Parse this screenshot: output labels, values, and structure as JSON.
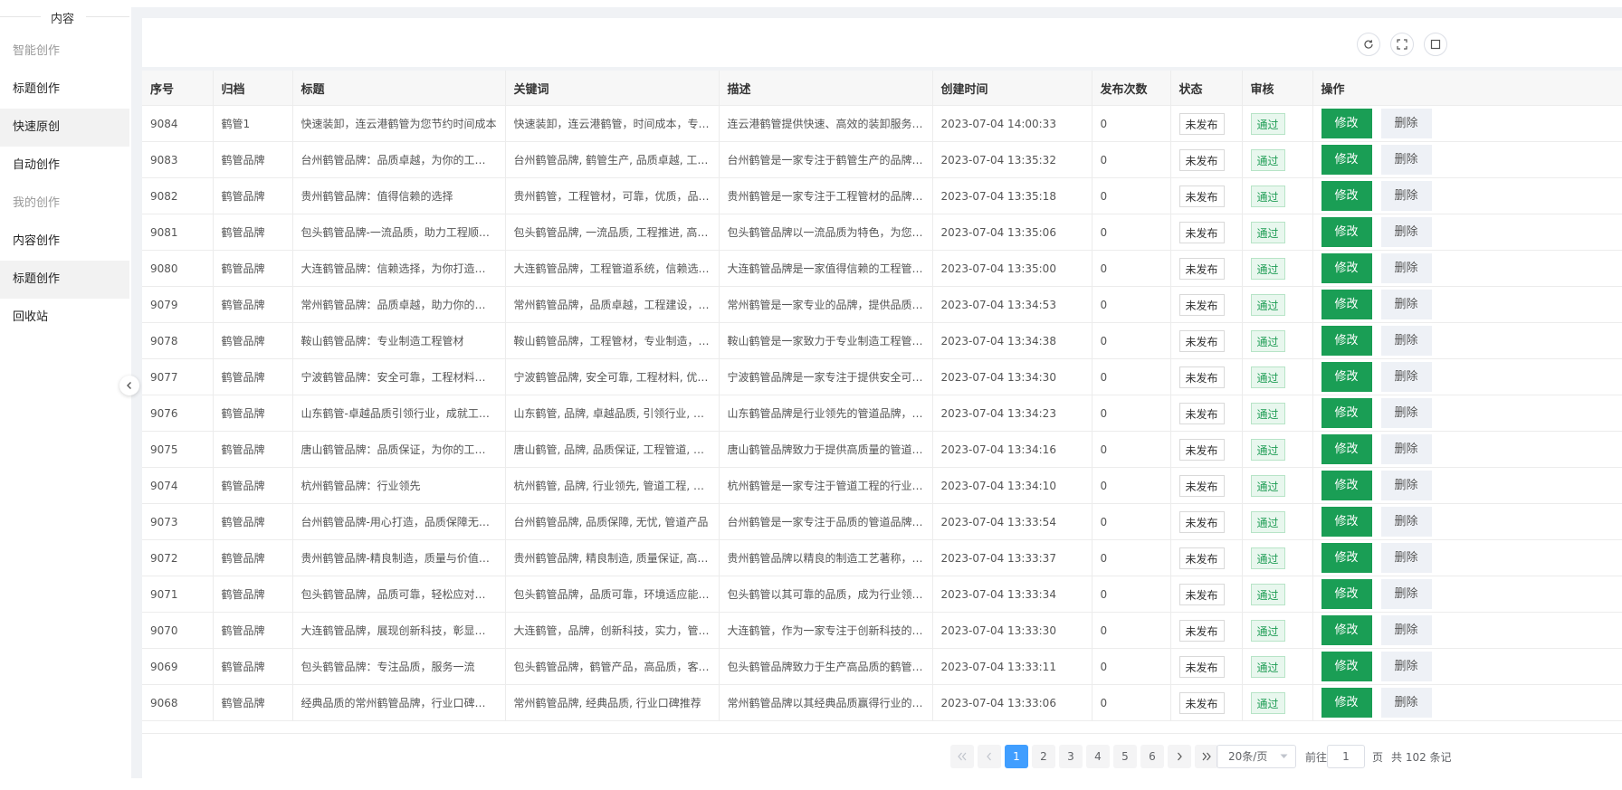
{
  "sidebar": {
    "header": "内容",
    "items": [
      {
        "label": "智能创作",
        "group": true
      },
      {
        "label": "标题创作"
      },
      {
        "label": "快速原创",
        "active": true
      },
      {
        "label": "自动创作"
      },
      {
        "label": "我的创作",
        "group": true
      },
      {
        "label": "内容创作"
      },
      {
        "label": "标题创作",
        "active": true
      },
      {
        "label": "回收站"
      }
    ]
  },
  "table": {
    "columns": [
      "序号",
      "归档",
      "标题",
      "关键词",
      "描述",
      "创建时间",
      "发布次数",
      "状态",
      "审核",
      "操作"
    ],
    "edit_label": "修改",
    "delete_label": "删除",
    "rows": [
      {
        "id": "9084",
        "archive": "鹤管1",
        "title": "快速装卸，连云港鹤管为您节约时间成本",
        "keywords": "快速装卸，连云港鹤管，时间成本，专业...",
        "desc": "连云港鹤管提供快速、高效的装卸服务，...",
        "time": "2023-07-04 14:00:33",
        "count": "0",
        "status": "未发布",
        "review": "通过"
      },
      {
        "id": "9083",
        "archive": "鹤管品牌",
        "title": "台州鹤管品牌：品质卓越，为你的工程保...",
        "keywords": "台州鹤管品牌, 鹤管生产, 品质卓越, 工程...",
        "desc": "台州鹤管是一家专注于鹤管生产的品牌，...",
        "time": "2023-07-04 13:35:32",
        "count": "0",
        "status": "未发布",
        "review": "通过"
      },
      {
        "id": "9082",
        "archive": "鹤管品牌",
        "title": "贵州鹤管品牌：值得信赖的选择",
        "keywords": "贵州鹤管，工程管材，可靠，优质，品牌...",
        "desc": "贵州鹤管是一家专注于工程管材的品牌，...",
        "time": "2023-07-04 13:35:18",
        "count": "0",
        "status": "未发布",
        "review": "通过"
      },
      {
        "id": "9081",
        "archive": "鹤管品牌",
        "title": "包头鹤管品牌-一流品质，助力工程顺利...",
        "keywords": "包头鹤管品牌, 一流品质, 工程推进, 高质...",
        "desc": "包头鹤管品牌以一流品质为特色，为您的...",
        "time": "2023-07-04 13:35:06",
        "count": "0",
        "status": "未发布",
        "review": "通过"
      },
      {
        "id": "9080",
        "archive": "鹤管品牌",
        "title": "大连鹤管品牌：信赖选择，为你打造可靠...",
        "keywords": "大连鹤管品牌，工程管道系统，信赖选择...",
        "desc": "大连鹤管品牌是一家值得信赖的工程管道...",
        "time": "2023-07-04 13:35:00",
        "count": "0",
        "status": "未发布",
        "review": "通过"
      },
      {
        "id": "9079",
        "archive": "鹤管品牌",
        "title": "常州鹤管品牌：品质卓越，助力你的工程...",
        "keywords": "常州鹤管品牌，品质卓越，工程建设，管...",
        "desc": "常州鹤管是一家专业的品牌，提供品质卓...",
        "time": "2023-07-04 13:34:53",
        "count": "0",
        "status": "未发布",
        "review": "通过"
      },
      {
        "id": "9078",
        "archive": "鹤管品牌",
        "title": "鞍山鹤管品牌：专业制造工程管材",
        "keywords": "鞍山鹤管品牌，工程管材，专业制造，卓...",
        "desc": "鞍山鹤管是一家致力于专业制造工程管材...",
        "time": "2023-07-04 13:34:38",
        "count": "0",
        "status": "未发布",
        "review": "通过"
      },
      {
        "id": "9077",
        "archive": "鹤管品牌",
        "title": "宁波鹤管品牌：安全可靠，工程材料优质...",
        "keywords": "宁波鹤管品牌, 安全可靠, 工程材料, 优质...",
        "desc": "宁波鹤管品牌是一家专注于提供安全可靠...",
        "time": "2023-07-04 13:34:30",
        "count": "0",
        "status": "未发布",
        "review": "通过"
      },
      {
        "id": "9076",
        "archive": "鹤管品牌",
        "title": "山东鹤管-卓越品质引领行业，成就工程...",
        "keywords": "山东鹤管, 品牌, 卓越品质, 引领行业, 工程...",
        "desc": "山东鹤管品牌是行业领先的管道品牌，以...",
        "time": "2023-07-04 13:34:23",
        "count": "0",
        "status": "未发布",
        "review": "通过"
      },
      {
        "id": "9075",
        "archive": "鹤管品牌",
        "title": "唐山鹤管品牌：品质保证，为你的工程保...",
        "keywords": "唐山鹤管, 品牌, 品质保证, 工程管道, 保驾...",
        "desc": "唐山鹤管品牌致力于提供高质量的管道产...",
        "time": "2023-07-04 13:34:16",
        "count": "0",
        "status": "未发布",
        "review": "通过"
      },
      {
        "id": "9074",
        "archive": "鹤管品牌",
        "title": "杭州鹤管品牌：行业领先",
        "keywords": "杭州鹤管, 品牌, 行业领先, 管道工程, 优质...",
        "desc": "杭州鹤管是一家专注于管道工程的行业领...",
        "time": "2023-07-04 13:34:10",
        "count": "0",
        "status": "未发布",
        "review": "通过"
      },
      {
        "id": "9073",
        "archive": "鹤管品牌",
        "title": "台州鹤管品牌-用心打造，品质保障无忧！",
        "keywords": "台州鹤管品牌, 品质保障, 无忧, 管道产品",
        "desc": "台州鹤管是一家专注于品质的管道品牌，...",
        "time": "2023-07-04 13:33:54",
        "count": "0",
        "status": "未发布",
        "review": "通过"
      },
      {
        "id": "9072",
        "archive": "鹤管品牌",
        "title": "贵州鹤管品牌-精良制造，质量与价值兼顾",
        "keywords": "贵州鹤管品牌, 精良制造, 质量保证, 高性...",
        "desc": "贵州鹤管品牌以精良的制造工艺著称，产...",
        "time": "2023-07-04 13:33:37",
        "count": "0",
        "status": "未发布",
        "review": "通过"
      },
      {
        "id": "9071",
        "archive": "鹤管品牌",
        "title": "包头鹤管品牌，品质可靠，轻松应对各种...",
        "keywords": "包头鹤管品牌，品质可靠，环境适应能力...",
        "desc": "包头鹤管以其可靠的品质，成为行业领先...",
        "time": "2023-07-04 13:33:34",
        "count": "0",
        "status": "未发布",
        "review": "通过"
      },
      {
        "id": "9070",
        "archive": "鹤管品牌",
        "title": "大连鹤管品牌，展现创新科技，彰显品牌...",
        "keywords": "大连鹤管，品牌，创新科技，实力，管道...",
        "desc": "大连鹤管，作为一家专注于创新科技的品...",
        "time": "2023-07-04 13:33:30",
        "count": "0",
        "status": "未发布",
        "review": "通过"
      },
      {
        "id": "9069",
        "archive": "鹤管品牌",
        "title": "包头鹤管品牌：专注品质，服务一流",
        "keywords": "包头鹤管品牌，鹤管产品，高品质，客户...",
        "desc": "包头鹤管品牌致力于生产高品质的鹤管产...",
        "time": "2023-07-04 13:33:11",
        "count": "0",
        "status": "未发布",
        "review": "通过"
      },
      {
        "id": "9068",
        "archive": "鹤管品牌",
        "title": "经典品质的常州鹤管品牌，行业口碑推荐！",
        "keywords": "常州鹤管品牌, 经典品质, 行业口碑推荐",
        "desc": "常州鹤管品牌以其经典品质赢得行业的口...",
        "time": "2023-07-04 13:33:06",
        "count": "0",
        "status": "未发布",
        "review": "通过"
      }
    ]
  },
  "pagination": {
    "pages": [
      "1",
      "2",
      "3",
      "4",
      "5",
      "6"
    ],
    "current": "1",
    "page_size": "20条/页",
    "goto_prefix": "前往",
    "goto_value": "1",
    "goto_suffix": "页",
    "total": "共 102 条记"
  }
}
